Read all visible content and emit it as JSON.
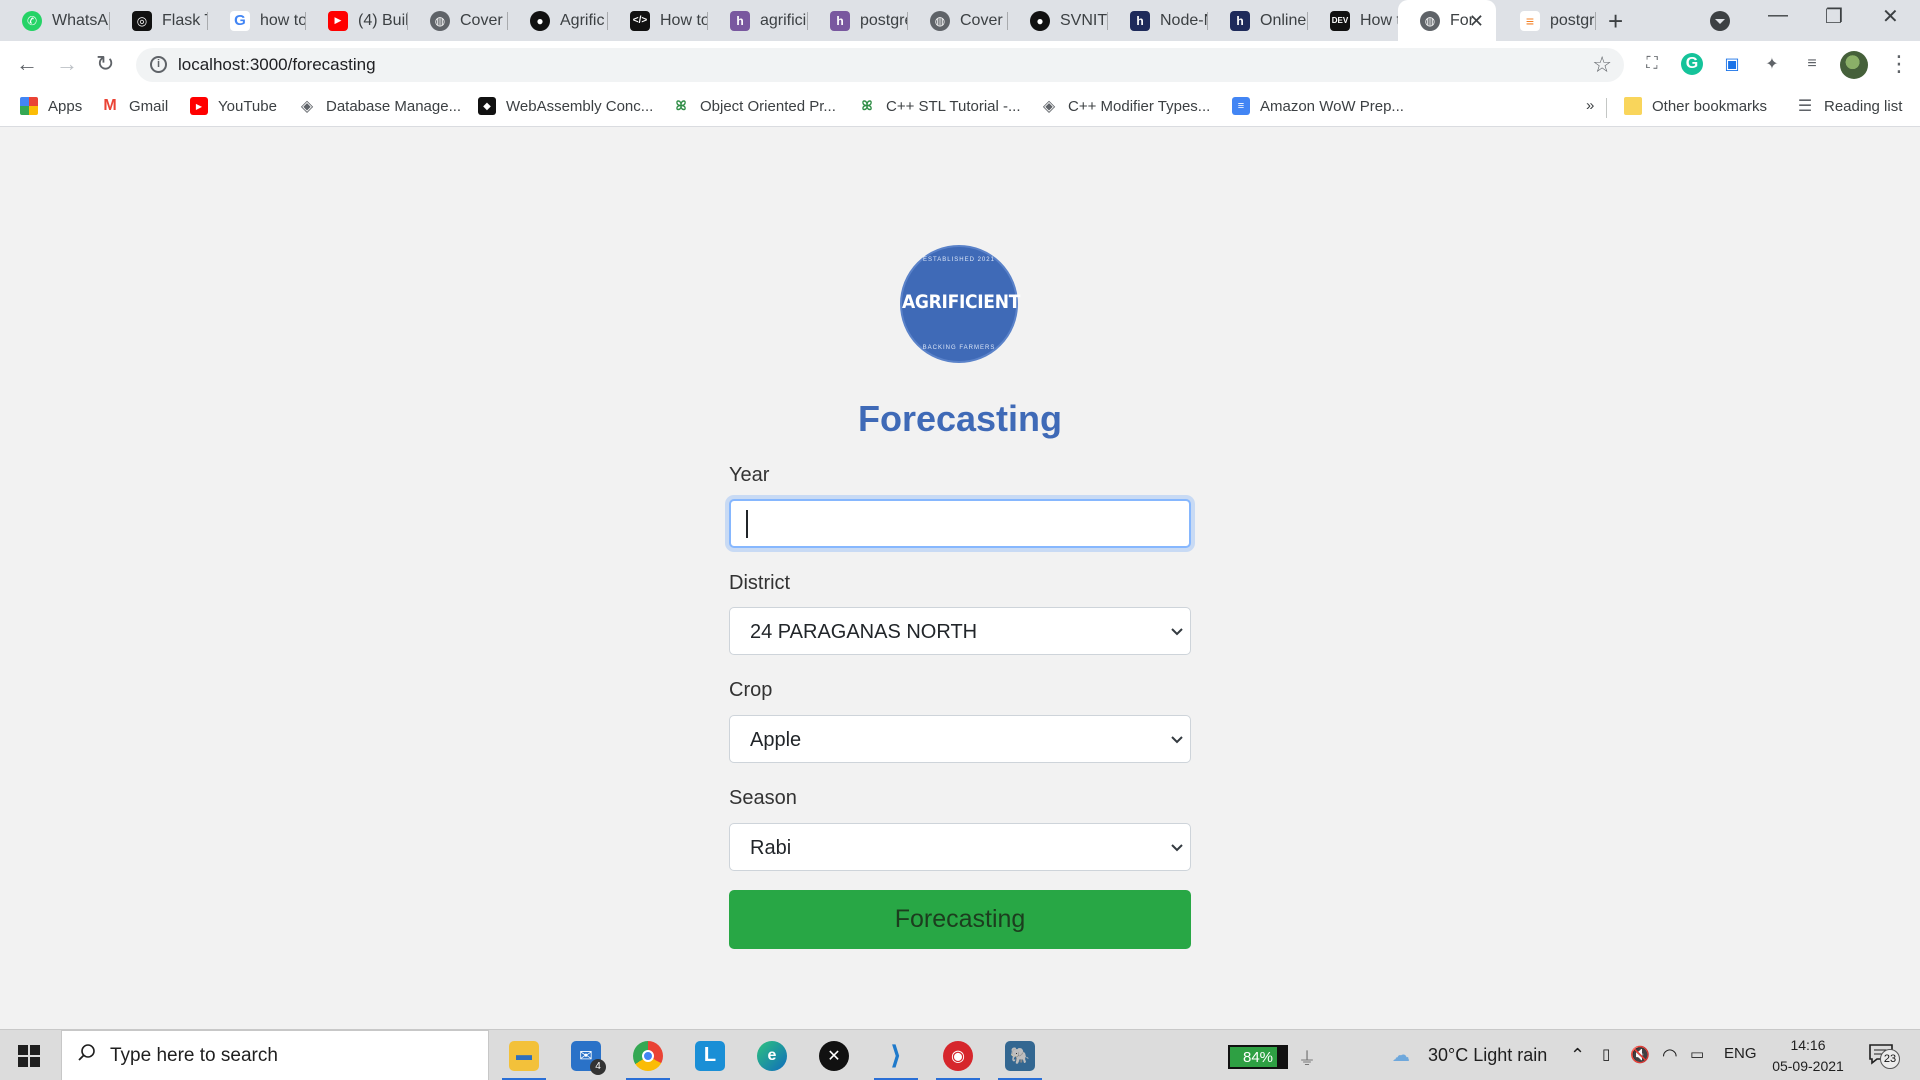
{
  "browser": {
    "tabs": [
      {
        "label": "WhatsA",
        "icon": "whatsapp-icon",
        "color": "#25d366"
      },
      {
        "label": "Flask Tu",
        "icon": "flask-icon",
        "color": "#111111"
      },
      {
        "label": "how to",
        "icon": "google-icon",
        "color": "#4285f4"
      },
      {
        "label": "(4) Buil",
        "icon": "youtube-icon",
        "color": "#ff0000"
      },
      {
        "label": "Cover T",
        "icon": "globe-icon",
        "color": "#5f6368"
      },
      {
        "label": "Agrific",
        "icon": "github-icon",
        "color": "#111111"
      },
      {
        "label": "How to",
        "icon": "code-icon",
        "color": "#111111"
      },
      {
        "label": "agrificie",
        "icon": "heroku-icon",
        "color": "#79589f"
      },
      {
        "label": "postgre",
        "icon": "heroku-icon",
        "color": "#79589f"
      },
      {
        "label": "Cover T",
        "icon": "globe-icon",
        "color": "#5f6368"
      },
      {
        "label": "SVNIT-",
        "icon": "github-icon",
        "color": "#111111"
      },
      {
        "label": "Node-N",
        "icon": "hashnode-icon",
        "color": "#1e2a5a"
      },
      {
        "label": "Online",
        "icon": "hashnode-icon",
        "color": "#1e2a5a"
      },
      {
        "label": "How to",
        "icon": "dev-icon",
        "color": "#111111"
      },
      {
        "label": "For",
        "icon": "globe-icon",
        "color": "#5f6368",
        "active": true
      },
      {
        "label": "postgre",
        "icon": "stackoverflow-icon",
        "color": "#f48024"
      }
    ],
    "url": "localhost:3000/forecasting",
    "bookmarks": [
      {
        "label": "Apps",
        "icon": "apps-grid-icon"
      },
      {
        "label": "Gmail",
        "icon": "gmail-icon"
      },
      {
        "label": "YouTube",
        "icon": "youtube-icon"
      },
      {
        "label": "Database Manage...",
        "icon": "diamond-icon"
      },
      {
        "label": "WebAssembly Conc...",
        "icon": "webassembly-icon"
      },
      {
        "label": "Object Oriented Pr...",
        "icon": "geeksforgeeks-icon"
      },
      {
        "label": "C++ STL Tutorial -...",
        "icon": "geeksforgeeks-icon"
      },
      {
        "label": "C++ Modifier Types...",
        "icon": "diamond-icon"
      },
      {
        "label": "Amazon WoW Prep...",
        "icon": "docs-icon"
      }
    ],
    "bookmarks_overflow": "»",
    "other_bookmarks": "Other bookmarks",
    "reading_list": "Reading list"
  },
  "page": {
    "logo": {
      "brand": "AGRIFICIENT",
      "top_arc": "ESTABLISHED 2021",
      "bottom_arc": "BACKING FARMERS",
      "color": "#3f6ab7"
    },
    "title": "Forecasting",
    "form": {
      "year_label": "Year",
      "year_value": "",
      "district_label": "District",
      "district_value": "24 PARAGANAS NORTH",
      "crop_label": "Crop",
      "crop_value": "Apple",
      "season_label": "Season",
      "season_value": "Rabi",
      "submit_label": "Forecasting",
      "submit_color": "#28a745"
    }
  },
  "taskbar": {
    "search_placeholder": "Type here to search",
    "mail_badge": "4",
    "battery": "84%",
    "battery_level": 0.84,
    "weather": "30°C  Light rain",
    "language": "ENG",
    "time": "14:16",
    "date": "05-09-2021",
    "notifications": "23"
  }
}
